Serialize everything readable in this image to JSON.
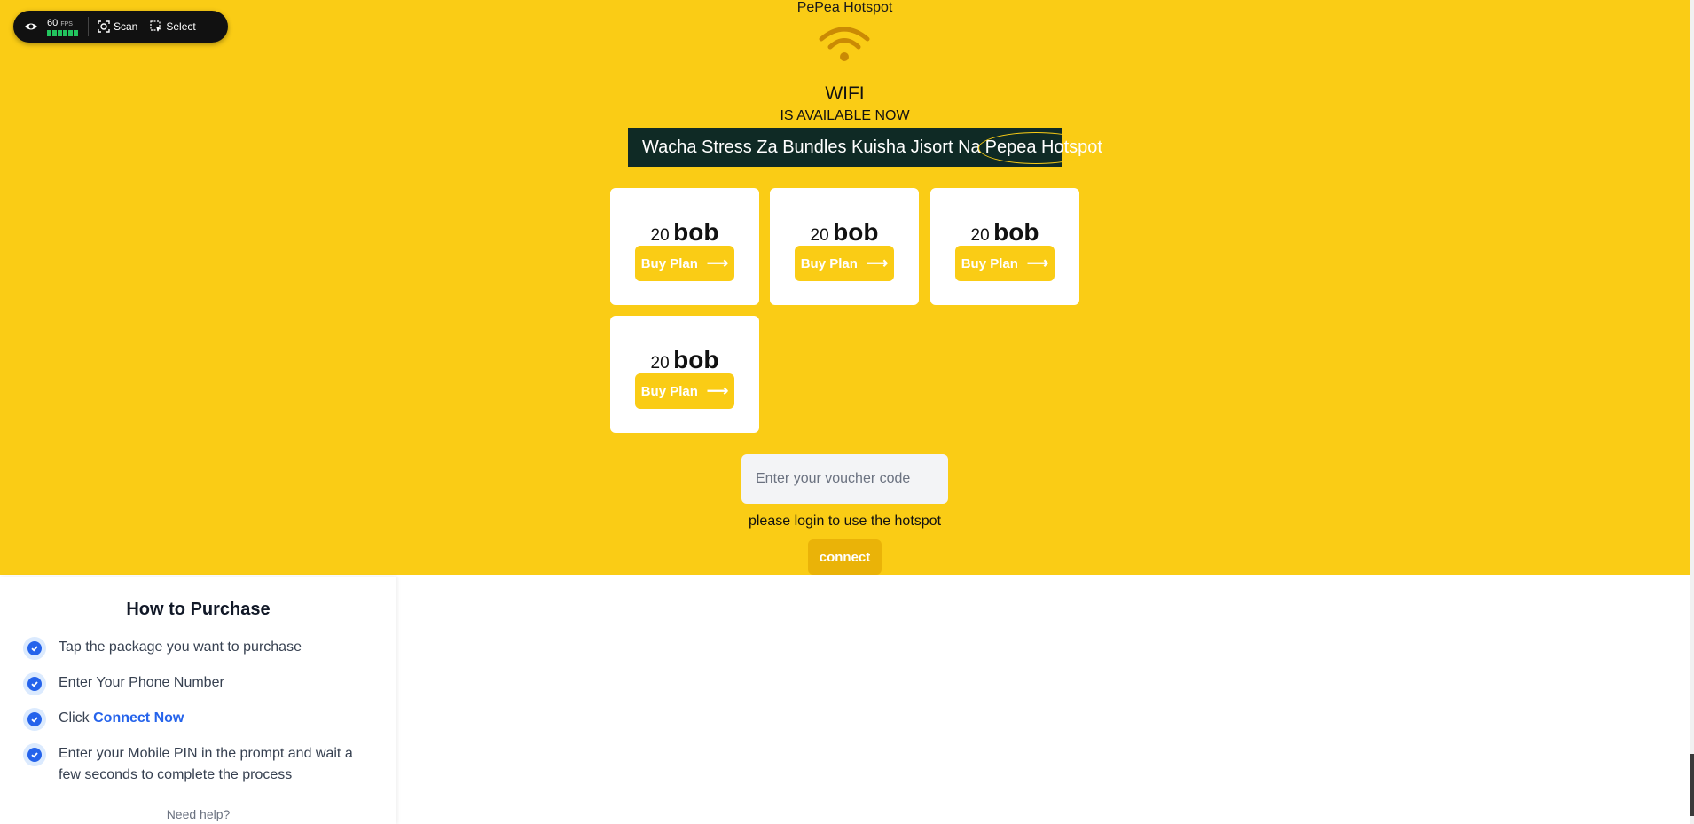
{
  "site": {
    "title": "PePea Hotspot",
    "wifi_label": "WIFI",
    "available_label": "IS AVAILABLE NOW",
    "banner_text": "Wacha Stress Za Bundles Kuisha Jisort Na",
    "banner_highlight": "Pepea Hotspot"
  },
  "plans": [
    {
      "amount": "20",
      "unit": "bob",
      "button": "Buy Plan"
    },
    {
      "amount": "20",
      "unit": "bob",
      "button": "Buy Plan"
    },
    {
      "amount": "20",
      "unit": "bob",
      "button": "Buy Plan"
    },
    {
      "amount": "20",
      "unit": "bob",
      "button": "Buy Plan"
    }
  ],
  "login": {
    "voucher_placeholder": "Enter your voucher code",
    "message": "please login to use the hotspot",
    "connect_label": "connect"
  },
  "how_to": {
    "title": "How to Purchase",
    "steps": [
      {
        "text": "Tap the package you want to purchase"
      },
      {
        "text": "Enter Your Phone Number"
      },
      {
        "prefix": "Click",
        "link": "Connect Now"
      },
      {
        "text": "Enter your Mobile PIN in the prompt and wait a few seconds to complete the process"
      }
    ],
    "help": "Need help?"
  },
  "toolbar": {
    "fps_value": "60",
    "fps_unit": "FPS",
    "scan_label": "Scan",
    "select_label": "Select"
  },
  "colors": {
    "brand_yellow": "#facc15",
    "banner_bg": "#0f2a25",
    "link_blue": "#2563eb"
  }
}
